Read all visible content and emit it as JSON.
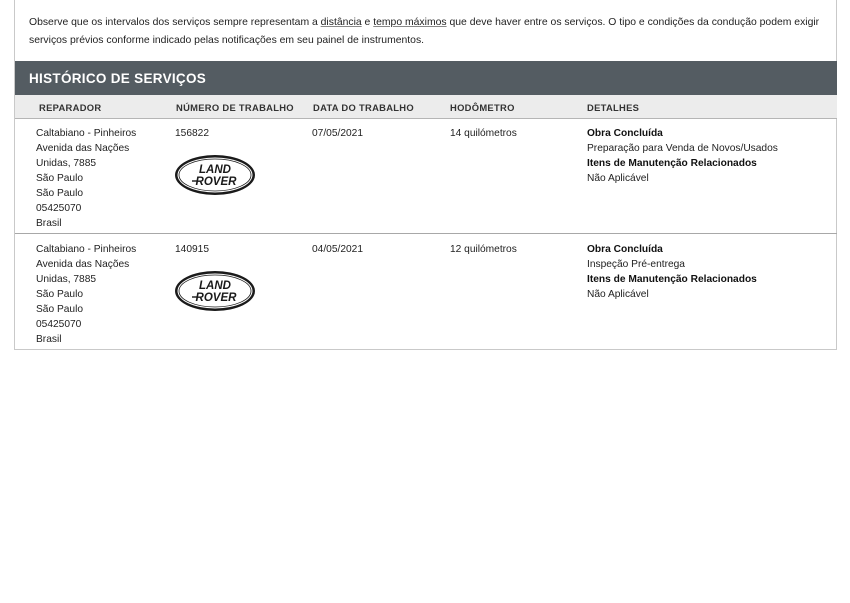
{
  "intro": {
    "part1": "Observe que os intervalos dos serviços sempre representam a ",
    "link1": "distância",
    "part2": " e ",
    "link2": "tempo máximos",
    "part3": " que deve haver entre os serviços. O tipo e condições da condução podem exigir",
    "line2": "serviços prévios conforme indicado pelas notificações em seu painel de instrumentos."
  },
  "section": {
    "title": "HISTÓRICO DE SERVIÇOS"
  },
  "columns": {
    "reparador": "REPARADOR",
    "numero": "NÚMERO DE TRABALHO",
    "data": "DATA DO TRABALHO",
    "hodometro": "HODÔMETRO",
    "detalhes": "DETALHES"
  },
  "logo": {
    "line1": "LAND",
    "line2": "ROVER"
  },
  "records": [
    {
      "address": [
        "Caltabiano - Pinheiros",
        "Avenida das Nações",
        "Unidas, 7885",
        "São Paulo",
        "São Paulo",
        "05425070",
        "Brasil"
      ],
      "job_number": "156822",
      "job_date": "07/05/2021",
      "odometer": "14 quilómetros",
      "status": "Obra Concluída",
      "service": "Preparação para Venda de Novos/Usados",
      "maint_label": "Itens de Manutenção Relacionados",
      "maint_value": "Não Aplicável"
    },
    {
      "address": [
        "Caltabiano - Pinheiros",
        "Avenida das Nações",
        "Unidas, 7885",
        "São Paulo",
        "São Paulo",
        "05425070",
        "Brasil"
      ],
      "job_number": "140915",
      "job_date": "04/05/2021",
      "odometer": "12 quilómetros",
      "status": "Obra Concluída",
      "service": "Inspeção Pré-entrega",
      "maint_label": "Itens de Manutenção Relacionados",
      "maint_value": "Não Aplicável"
    }
  ]
}
